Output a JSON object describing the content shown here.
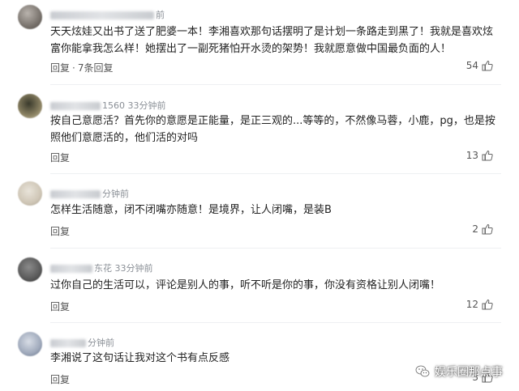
{
  "comments": [
    {
      "meta_suffix": "前",
      "text": "天天炫娃又出书了送了肥婆一本！李湘喜欢那句话摆明了是计划一条路走到黑了！我就是喜欢炫富你能拿我怎么样！她摆出了一副死猪怕开水烫的架势！我就愿意做中国最负面的人！",
      "reply": "回复",
      "sub_replies": "7条回复",
      "likes": "54"
    },
    {
      "meta_suffix": "1560 33分钟前",
      "text": "按自己意愿活？首先你的意愿是正能量，是正三观的...等等的，不然像马蓉，小鹿，pg，也是按照他们意愿活的，他们活的对吗",
      "reply": "回复",
      "likes": "13"
    },
    {
      "meta_suffix": "分钟前",
      "text": "怎样生活随意，闭不闭嘴亦随意！是境界，让人闭嘴，是装B",
      "reply": "回复",
      "likes": "2"
    },
    {
      "meta_suffix": "东花 33分钟前",
      "text": "过你自己的生活可以，评论是别人的事，听不听是你的事，你没有资格让别人闭嘴！",
      "reply": "回复",
      "likes": "12"
    },
    {
      "meta_suffix": "分钟前",
      "text": "李湘说了这句话让我对这个书有点反感",
      "reply": "回复",
      "likes": "3"
    }
  ],
  "watermark": {
    "text": "娱乐圈那点事",
    "icon": "wechat-icon"
  },
  "icons": {
    "like": "thumbs-up-icon"
  }
}
